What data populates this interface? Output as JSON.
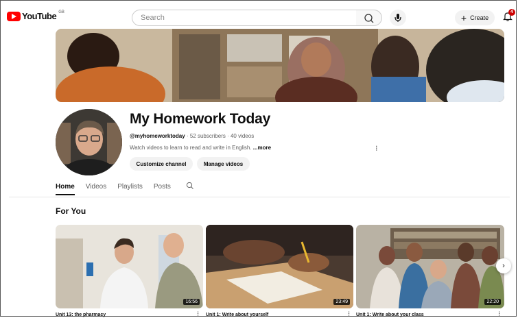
{
  "header": {
    "logo_text": "YouTube",
    "logo_country": "GB",
    "search_placeholder": "Search",
    "create_label": "Create",
    "notification_count": "4"
  },
  "channel": {
    "name": "My Homework Today",
    "handle": "@myhomeworktoday",
    "stats": " · 52 subscribers · 40 videos",
    "description": "Watch videos to learn to read and write in English. ",
    "more_label": "...more",
    "customize_label": "Customize channel",
    "manage_label": "Manage videos"
  },
  "tabs": [
    "Home",
    "Videos",
    "Playlists",
    "Posts"
  ],
  "section_title": "For You",
  "videos": [
    {
      "title": "Unit 13: the pharmacy",
      "duration": "16:56"
    },
    {
      "title": "Unit 1: Write about yourself",
      "duration": "23:49"
    },
    {
      "title": "Unit 1: Write about your class",
      "duration": "22:20"
    }
  ],
  "icons": {
    "search": "search-icon",
    "mic": "mic-icon",
    "bell": "bell-icon",
    "next": "chevron-right-icon"
  },
  "colors": {
    "brand_red": "#ff0000",
    "badge_red": "#cc0000",
    "pill_gray": "#f2f2f2"
  }
}
